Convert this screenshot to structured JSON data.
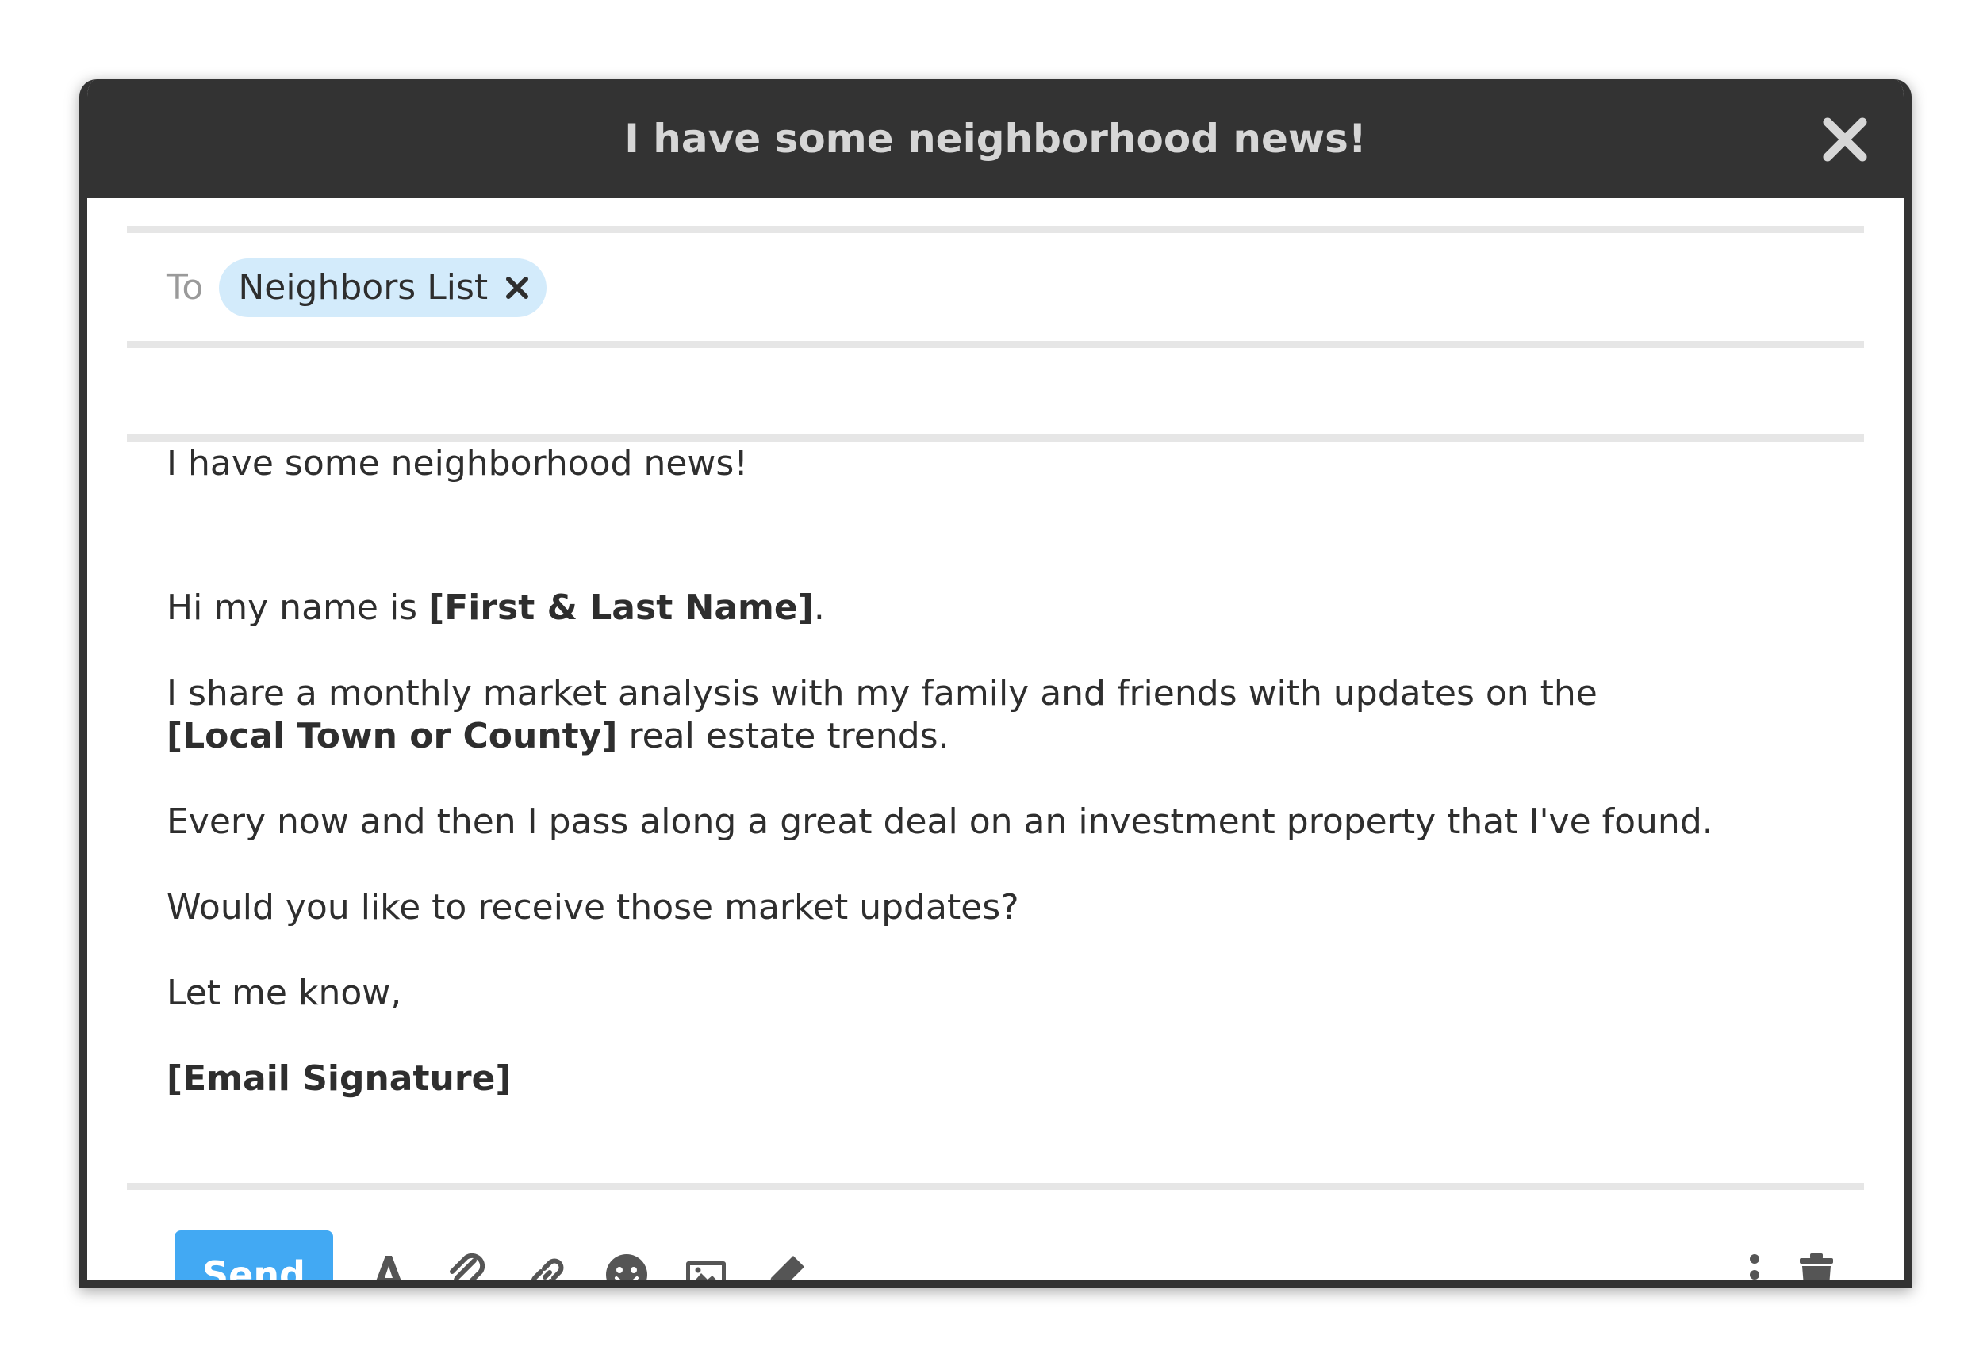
{
  "window": {
    "title": "I have some neighborhood news!"
  },
  "recipients": {
    "to_label": "To",
    "chips": [
      {
        "label": "Neighbors List"
      }
    ]
  },
  "subject": "I have some neighborhood news!",
  "body": {
    "p1_prefix": "Hi my name is ",
    "p1_bold": "[First & Last Name]",
    "p1_suffix": ".",
    "p2_line1": "I share a monthly market analysis with my family and friends with updates on the",
    "p2_bold": "[Local Town or County]",
    "p2_suffix": " real estate trends.",
    "p3": "Every now and then I pass along a great deal on an investment property that I've found.",
    "p4": "Would you like to receive those market updates?",
    "p5": "Let me know,",
    "signature": "[Email Signature]"
  },
  "toolbar": {
    "send_label": "Send",
    "icons": [
      "text-format-icon",
      "paperclip-icon",
      "link-icon",
      "emoji-icon",
      "image-icon",
      "pen-icon",
      "more-vertical-icon",
      "trash-icon"
    ]
  },
  "colors": {
    "title_bar": "#333333",
    "title_text": "#d6d6d6",
    "send_button": "#42a9f3",
    "chip_background": "#d3ebfb",
    "divider": "#e6e6e6"
  }
}
